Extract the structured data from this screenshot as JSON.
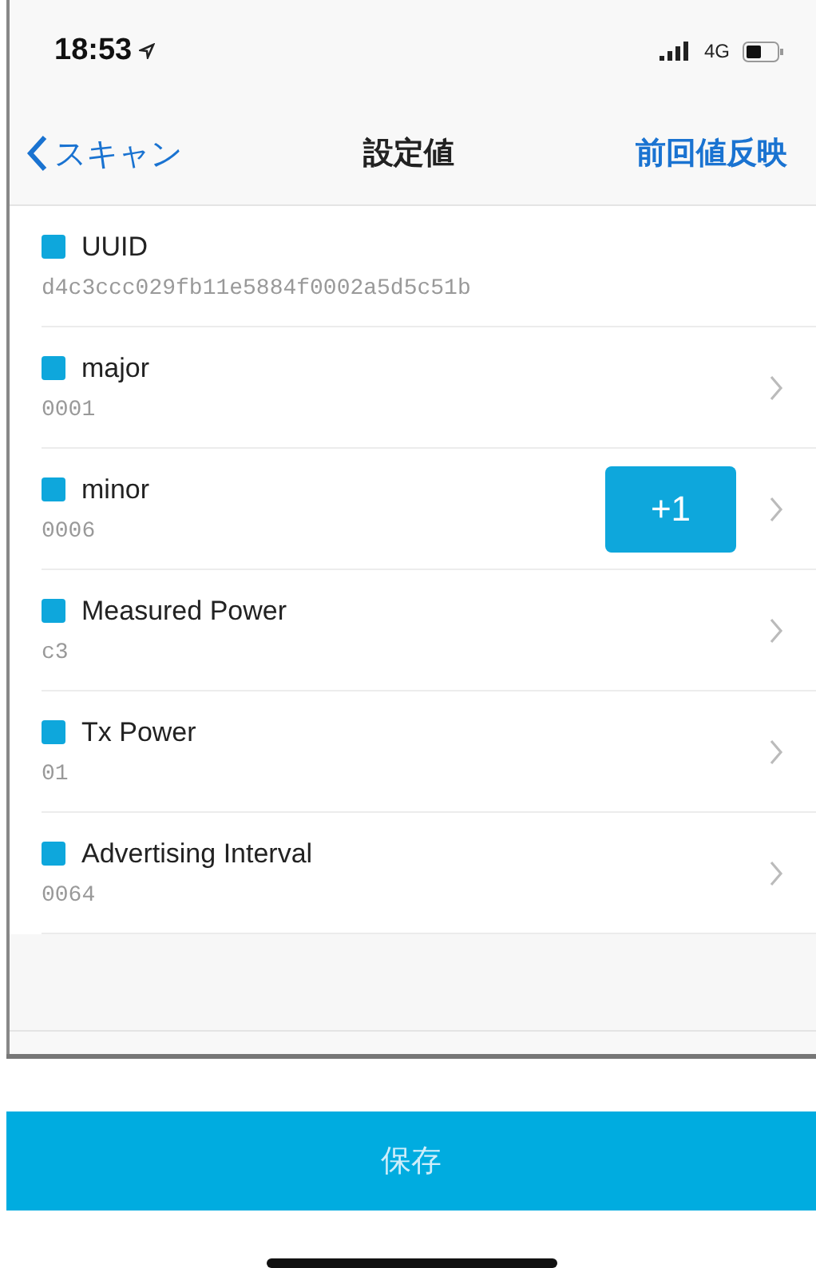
{
  "status_bar": {
    "time": "18:53",
    "network": "4G"
  },
  "nav": {
    "back": "スキャン",
    "title": "設定値",
    "action": "前回値反映"
  },
  "rows": [
    {
      "name": "UUID",
      "value": "d4c3ccc029fb11e5884f0002a5d5c51b",
      "chevron": false
    },
    {
      "name": "major",
      "value": "0001",
      "chevron": true
    },
    {
      "name": "minor",
      "value": "0006",
      "chevron": true,
      "button": "+1"
    },
    {
      "name": "Measured Power",
      "value": "c3",
      "chevron": true
    },
    {
      "name": "Tx Power",
      "value": "01",
      "chevron": true
    },
    {
      "name": "Advertising Interval",
      "value": "0064",
      "chevron": true
    }
  ],
  "save_button": "保存"
}
